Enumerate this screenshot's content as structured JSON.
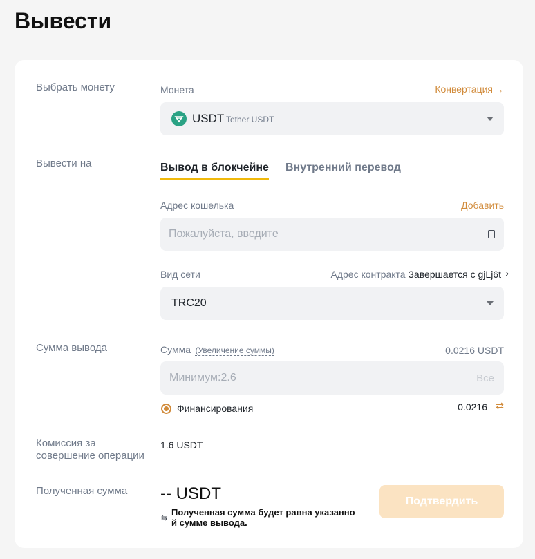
{
  "page": {
    "title": "Вывести"
  },
  "coin_section": {
    "label": "Выбрать монету",
    "field_label": "Монета",
    "convert_link": "Конвертация",
    "symbol": "USDT",
    "name": "Tether USDT",
    "icon_color": "#2aa284"
  },
  "destination_section": {
    "label": "Вывести на",
    "tabs": [
      {
        "label": "Вывод в блокчейне",
        "active": true
      },
      {
        "label": "Внутренний перевод",
        "active": false
      }
    ],
    "address_label": "Адрес кошелька",
    "add_link": "Добавить",
    "address_placeholder": "Пожалуйста, введите",
    "network_label": "Вид сети",
    "contract_label": "Адрес контракта",
    "contract_value": "Завершается с gjLj6t",
    "network_value": "TRC20"
  },
  "amount_section": {
    "label": "Сумма вывода",
    "field_label": "Сумма",
    "increase_link": "(Увеличение суммы)",
    "available": "0.0216 USDT",
    "placeholder": "Минимум:2.6",
    "all_button": "Все",
    "funding_label": "Финансирования",
    "funding_value": "0.0216"
  },
  "fee_section": {
    "label_line1": "Комиссия за",
    "label_line2": "совершение операции",
    "value": "1.6 USDT"
  },
  "receive_section": {
    "label": "Полученная сумма",
    "amount": "-- USDT",
    "note_line1": "Полученная сумма будет равна указанно",
    "note_line2": "й сумме вывода.",
    "confirm_button": "Подтвердить"
  },
  "colors": {
    "accent": "#f0b90b",
    "link": "#d18b3b",
    "button_disabled": "#fbe3c2"
  }
}
